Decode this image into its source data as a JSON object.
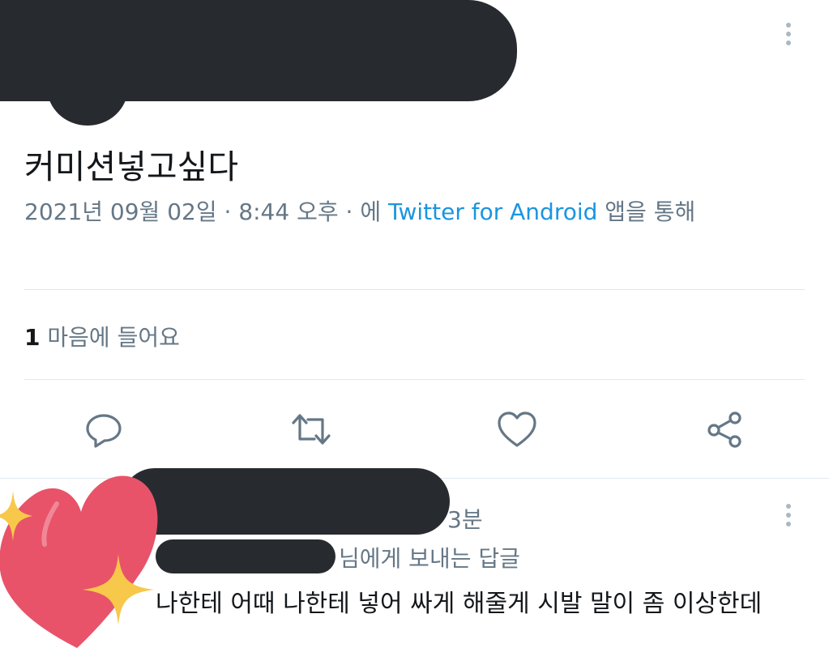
{
  "tweet": {
    "text": "커미션넣고싶다",
    "date": "2021년 09월 02일",
    "sep1": " · ",
    "time": "8:44 오후",
    "sep2": " · 에 ",
    "source": "Twitter for Android",
    "source_suffix": " 앱을 통해"
  },
  "stats": {
    "likes_count": "1",
    "likes_label": " 마음에 들어요"
  },
  "actions": [
    "reply-icon",
    "retweet-icon",
    "like-icon",
    "share-icon"
  ],
  "reply": {
    "time": "3분",
    "replying_to": "님에게 보내는 답글",
    "text": "나한테 어때 나한테 넣어 싸게 해줄게 시발 말이 좀 이상한데"
  },
  "colors": {
    "text": "#14171a",
    "secondary": "#657786",
    "link": "#1b95e0",
    "divider": "#e1e8ed",
    "redaction": "#272b2f",
    "heart_sticker": "#e8536a",
    "sparkle": "#f7c84a"
  }
}
